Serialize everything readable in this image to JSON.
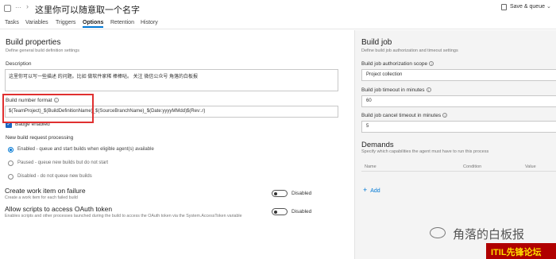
{
  "header": {
    "title": "这里你可以随意取一个名字",
    "ellipsis": "···",
    "save_queue_label": "Save & queue"
  },
  "tabs": [
    "Tasks",
    "Variables",
    "Triggers",
    "Options",
    "Retention",
    "History"
  ],
  "active_tab": "Options",
  "build_properties": {
    "title": "Build properties",
    "subtitle": "Define general build definition settings",
    "description_label": "Description",
    "description_value": "这里你可以写一些描述 的问题。比如 做软件家稀 棒棒哒。    关注 微信公众号 角落的白板报",
    "build_number_label": "Build number format",
    "build_number_value": "$(TeamProject)_$(BuildDefinitionName)_$(SourceBranchName)_$(Date:yyyyMMdd)$(Rev:.r)",
    "badge_label": "Badge enabled"
  },
  "new_build": {
    "title": "New build request processing",
    "options": [
      "Enabled - queue and start builds when eligible agent(s) available",
      "Paused - queue new builds but do not start",
      "Disabled - do not queue new builds"
    ],
    "selected_index": 0
  },
  "work_item": {
    "title": "Create work item on failure",
    "subtitle": "Create a work item for each failed build",
    "toggle_label": "Disabled"
  },
  "oauth": {
    "title": "Allow scripts to access OAuth token",
    "subtitle": "Enables scripts and other processes launched during the build to access the OAuth token via the System.AccessToken variable",
    "toggle_label": "Disabled"
  },
  "build_job": {
    "title": "Build job",
    "subtitle": "Define build job authorization and timeout settings",
    "scope_label": "Build job authorization scope",
    "scope_value": "Project collection",
    "timeout_label": "Build job timeout in minutes",
    "timeout_value": "60",
    "cancel_label": "Build job cancel timeout in minutes",
    "cancel_value": "5"
  },
  "demands": {
    "title": "Demands",
    "subtitle": "Specify which capabilities the agent must have to run this process",
    "col_name": "Name",
    "col_condition": "Condition",
    "col_value": "Value",
    "add_label": "Add"
  },
  "watermark": {
    "text": "角落的白板报",
    "footer": "ITIL先锋论坛"
  },
  "colors": {
    "accent": "#0078d4",
    "highlight_box": "#e03030",
    "checkbox": "#1a66c2",
    "watermark_bg": "#b00000"
  }
}
